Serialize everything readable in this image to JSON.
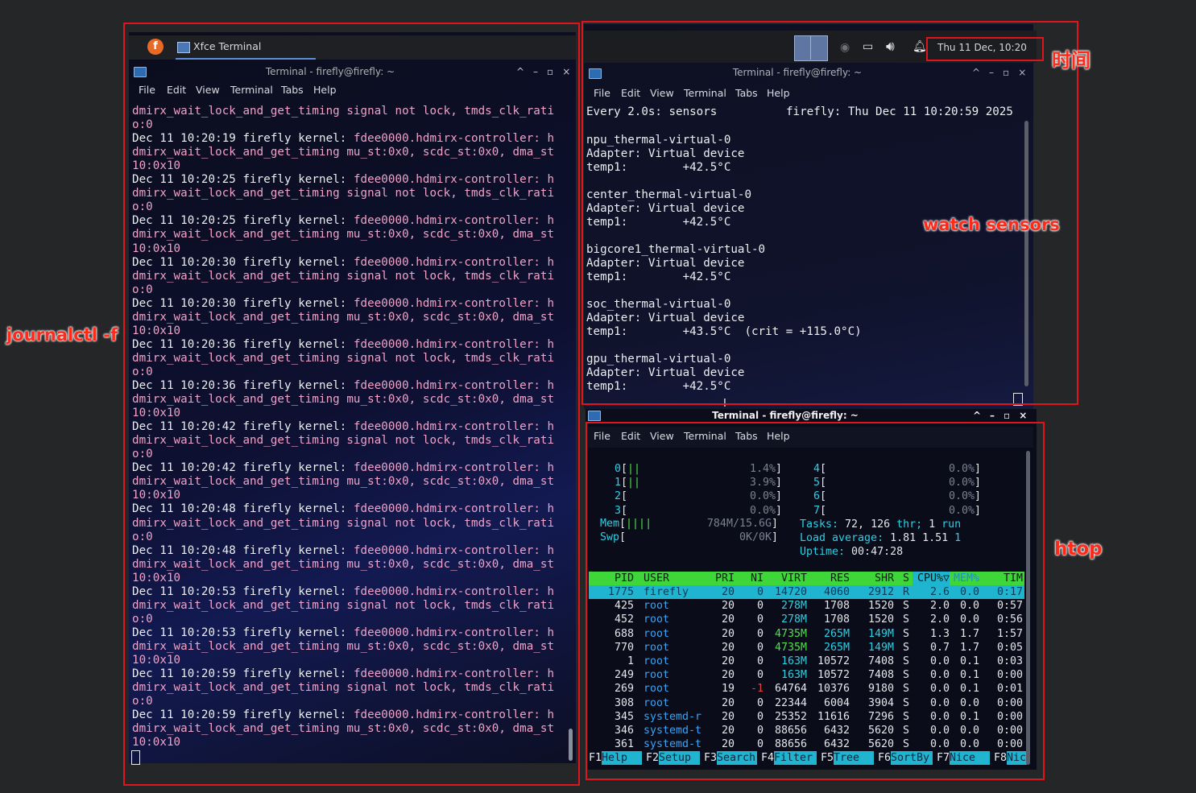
{
  "annotations": {
    "journal": "journalctl -f",
    "time": "时间",
    "sensors": "watch sensors",
    "htop": "htop"
  },
  "taskbar": {
    "app_label": "Xfce Terminal",
    "clock": "Thu 11 Dec, 10:20"
  },
  "windows": {
    "title": "Terminal - firefly@firefly: ~",
    "menu": [
      "File",
      "Edit",
      "View",
      "Terminal",
      "Tabs",
      "Help"
    ]
  },
  "journal": {
    "lines": [
      {
        "t": "dmirx_wait_lock_and_get_timing signal not lock, tmds_clk_rati",
        "c": "pink"
      },
      {
        "t": "o:0",
        "c": "pink"
      },
      {
        "t": "Dec 11 10:20:19 firefly kernel: ",
        "c": "wht",
        "tail": "fdee0000.hdmirx-controller: h"
      },
      {
        "t": "dmirx_wait_lock_and_get_timing mu_st:0x0, scdc_st:0x0, dma_st",
        "c": "pink"
      },
      {
        "t": "10:0x10",
        "c": "pink"
      },
      {
        "t": "Dec 11 10:20:25 firefly kernel: ",
        "c": "wht",
        "tail": "fdee0000.hdmirx-controller: h"
      },
      {
        "t": "dmirx_wait_lock_and_get_timing signal not lock, tmds_clk_rati",
        "c": "pink"
      },
      {
        "t": "o:0",
        "c": "pink"
      },
      {
        "t": "Dec 11 10:20:25 firefly kernel: ",
        "c": "wht",
        "tail": "fdee0000.hdmirx-controller: h"
      },
      {
        "t": "dmirx_wait_lock_and_get_timing mu_st:0x0, scdc_st:0x0, dma_st",
        "c": "pink"
      },
      {
        "t": "10:0x10",
        "c": "pink"
      },
      {
        "t": "Dec 11 10:20:30 firefly kernel: ",
        "c": "wht",
        "tail": "fdee0000.hdmirx-controller: h"
      },
      {
        "t": "dmirx_wait_lock_and_get_timing signal not lock, tmds_clk_rati",
        "c": "pink"
      },
      {
        "t": "o:0",
        "c": "pink"
      },
      {
        "t": "Dec 11 10:20:30 firefly kernel: ",
        "c": "wht",
        "tail": "fdee0000.hdmirx-controller: h"
      },
      {
        "t": "dmirx_wait_lock_and_get_timing mu_st:0x0, scdc_st:0x0, dma_st",
        "c": "pink"
      },
      {
        "t": "10:0x10",
        "c": "pink"
      },
      {
        "t": "Dec 11 10:20:36 firefly kernel: ",
        "c": "wht",
        "tail": "fdee0000.hdmirx-controller: h"
      },
      {
        "t": "dmirx_wait_lock_and_get_timing signal not lock, tmds_clk_rati",
        "c": "pink"
      },
      {
        "t": "o:0",
        "c": "pink"
      },
      {
        "t": "Dec 11 10:20:36 firefly kernel: ",
        "c": "wht",
        "tail": "fdee0000.hdmirx-controller: h"
      },
      {
        "t": "dmirx_wait_lock_and_get_timing mu_st:0x0, scdc_st:0x0, dma_st",
        "c": "pink"
      },
      {
        "t": "10:0x10",
        "c": "pink"
      },
      {
        "t": "Dec 11 10:20:42 firefly kernel: ",
        "c": "wht",
        "tail": "fdee0000.hdmirx-controller: h"
      },
      {
        "t": "dmirx_wait_lock_and_get_timing signal not lock, tmds_clk_rati",
        "c": "pink"
      },
      {
        "t": "o:0",
        "c": "pink"
      },
      {
        "t": "Dec 11 10:20:42 firefly kernel: ",
        "c": "wht",
        "tail": "fdee0000.hdmirx-controller: h"
      },
      {
        "t": "dmirx_wait_lock_and_get_timing mu_st:0x0, scdc_st:0x0, dma_st",
        "c": "pink"
      },
      {
        "t": "10:0x10",
        "c": "pink"
      },
      {
        "t": "Dec 11 10:20:48 firefly kernel: ",
        "c": "wht",
        "tail": "fdee0000.hdmirx-controller: h"
      },
      {
        "t": "dmirx_wait_lock_and_get_timing signal not lock, tmds_clk_rati",
        "c": "pink"
      },
      {
        "t": "o:0",
        "c": "pink"
      },
      {
        "t": "Dec 11 10:20:48 firefly kernel: ",
        "c": "wht",
        "tail": "fdee0000.hdmirx-controller: h"
      },
      {
        "t": "dmirx_wait_lock_and_get_timing mu_st:0x0, scdc_st:0x0, dma_st",
        "c": "pink"
      },
      {
        "t": "10:0x10",
        "c": "pink"
      },
      {
        "t": "Dec 11 10:20:53 firefly kernel: ",
        "c": "wht",
        "tail": "fdee0000.hdmirx-controller: h"
      },
      {
        "t": "dmirx_wait_lock_and_get_timing signal not lock, tmds_clk_rati",
        "c": "pink"
      },
      {
        "t": "o:0",
        "c": "pink"
      },
      {
        "t": "Dec 11 10:20:53 firefly kernel: ",
        "c": "wht",
        "tail": "fdee0000.hdmirx-controller: h"
      },
      {
        "t": "dmirx_wait_lock_and_get_timing mu_st:0x0, scdc_st:0x0, dma_st",
        "c": "pink"
      },
      {
        "t": "10:0x10",
        "c": "pink"
      },
      {
        "t": "Dec 11 10:20:59 firefly kernel: ",
        "c": "wht",
        "tail": "fdee0000.hdmirx-controller: h"
      },
      {
        "t": "dmirx_wait_lock_and_get_timing signal not lock, tmds_clk_rati",
        "c": "pink"
      },
      {
        "t": "o:0",
        "c": "pink"
      },
      {
        "t": "Dec 11 10:20:59 firefly kernel: ",
        "c": "wht",
        "tail": "fdee0000.hdmirx-controller: h"
      },
      {
        "t": "dmirx_wait_lock_and_get_timing mu_st:0x0, scdc_st:0x0, dma_st",
        "c": "pink"
      },
      {
        "t": "10:0x10",
        "c": "pink"
      }
    ]
  },
  "sensors": {
    "header_left": "Every 2.0s: sensors",
    "header_right": "firefly: Thu Dec 11 10:20:59 2025",
    "blocks": [
      {
        "name": "npu_thermal-virtual-0",
        "adapter": "Adapter: Virtual device",
        "temp": "temp1:        +42.5°C"
      },
      {
        "name": "center_thermal-virtual-0",
        "adapter": "Adapter: Virtual device",
        "temp": "temp1:        +42.5°C"
      },
      {
        "name": "bigcore1_thermal-virtual-0",
        "adapter": "Adapter: Virtual device",
        "temp": "temp1:        +42.5°C"
      },
      {
        "name": "soc_thermal-virtual-0",
        "adapter": "Adapter: Virtual device",
        "temp": "temp1:        +43.5°C  (crit = +115.0°C)"
      },
      {
        "name": "gpu_thermal-virtual-0",
        "adapter": "Adapter: Virtual device",
        "temp": "temp1:        +42.5°C"
      }
    ]
  },
  "htop": {
    "cpus_left": [
      {
        "id": "0",
        "bar": "||",
        "val": "1.4%"
      },
      {
        "id": "1",
        "bar": "||",
        "val": "3.9%"
      },
      {
        "id": "2",
        "bar": "",
        "val": "0.0%"
      },
      {
        "id": "3",
        "bar": "",
        "val": "0.0%"
      }
    ],
    "cpus_right": [
      {
        "id": "4",
        "bar": "",
        "val": "0.0%"
      },
      {
        "id": "5",
        "bar": "",
        "val": "0.0%"
      },
      {
        "id": "6",
        "bar": "",
        "val": "0.0%"
      },
      {
        "id": "7",
        "bar": "",
        "val": "0.0%"
      }
    ],
    "mem": {
      "label": "Mem",
      "bar": "||||",
      "val": "784M/15.6G"
    },
    "swp": {
      "label": "Swp",
      "val": "0K/0K"
    },
    "tasks": {
      "label": "Tasks:",
      "count": "72,",
      "thr": "126",
      "thr_label": "thr;",
      "run": "1",
      "run_label": "run"
    },
    "load": {
      "label": "Load average:",
      "v1": "1.81",
      "v2": "1.51",
      "v3": "1"
    },
    "uptime": {
      "label": "Uptime:",
      "val": "00:47:28"
    },
    "columns": [
      "PID",
      "USER",
      "PRI",
      "NI",
      "VIRT",
      "RES",
      "SHR",
      "S",
      "CPU%▽",
      "MEM%",
      "TIM"
    ],
    "rows": [
      [
        "1775",
        "firefly",
        "20",
        "0",
        "14720",
        "4060",
        "2912",
        "R",
        "2.6",
        "0.0",
        "0:17"
      ],
      [
        "425",
        "root",
        "20",
        "0",
        "278M",
        "1708",
        "1520",
        "S",
        "2.0",
        "0.0",
        "0:57"
      ],
      [
        "452",
        "root",
        "20",
        "0",
        "278M",
        "1708",
        "1520",
        "S",
        "2.0",
        "0.0",
        "0:56"
      ],
      [
        "688",
        "root",
        "20",
        "0",
        "4735M",
        "265M",
        "149M",
        "S",
        "1.3",
        "1.7",
        "1:57"
      ],
      [
        "770",
        "root",
        "20",
        "0",
        "4735M",
        "265M",
        "149M",
        "S",
        "0.7",
        "1.7",
        "0:05"
      ],
      [
        "1",
        "root",
        "20",
        "0",
        "163M",
        "10572",
        "7408",
        "S",
        "0.0",
        "0.1",
        "0:03"
      ],
      [
        "249",
        "root",
        "20",
        "0",
        "163M",
        "10572",
        "7408",
        "S",
        "0.0",
        "0.1",
        "0:00"
      ],
      [
        "269",
        "root",
        "19",
        "-1",
        "64764",
        "10376",
        "9180",
        "S",
        "0.0",
        "0.1",
        "0:01"
      ],
      [
        "308",
        "root",
        "20",
        "0",
        "22344",
        "6004",
        "3904",
        "S",
        "0.0",
        "0.0",
        "0:00"
      ],
      [
        "345",
        "systemd-r",
        "20",
        "0",
        "25352",
        "11616",
        "7296",
        "S",
        "0.0",
        "0.1",
        "0:00"
      ],
      [
        "346",
        "systemd-t",
        "20",
        "0",
        "88656",
        "6432",
        "5620",
        "S",
        "0.0",
        "0.0",
        "0:00"
      ],
      [
        "361",
        "systemd-t",
        "20",
        "0",
        "88656",
        "6432",
        "5620",
        "S",
        "0.0",
        "0.0",
        "0:00"
      ]
    ],
    "fkeys": [
      {
        "k": "F1",
        "v": "Help  "
      },
      {
        "k": "F2",
        "v": "Setup "
      },
      {
        "k": "F3",
        "v": "Search"
      },
      {
        "k": "F4",
        "v": "Filter"
      },
      {
        "k": "F5",
        "v": "Tree  "
      },
      {
        "k": "F6",
        "v": "SortBy"
      },
      {
        "k": "F7",
        "v": "Nice  "
      },
      {
        "k": "F8",
        "v": "Nic"
      }
    ]
  },
  "colors": {
    "annotation": "#e0141c",
    "htop_header_bg": "#3fd63a",
    "htop_selected_bg": "#1fb4cf",
    "journal_pink": "#f0a2c8"
  }
}
